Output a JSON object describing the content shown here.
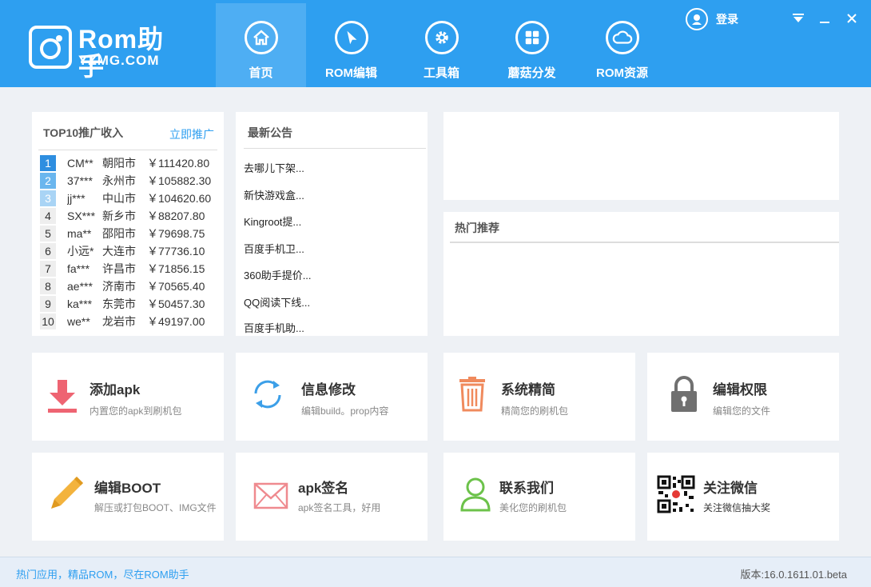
{
  "app": {
    "logo_text": "Rom助手",
    "logo_domain": "YZMG.COM"
  },
  "nav": [
    {
      "label": "首页",
      "icon": "home-icon",
      "active": true
    },
    {
      "label": "ROM编辑",
      "icon": "cursor-icon",
      "active": false
    },
    {
      "label": "工具箱",
      "icon": "gear-icon",
      "active": false
    },
    {
      "label": "蘑菇分发",
      "icon": "grid-icon",
      "active": false
    },
    {
      "label": "ROM资源",
      "icon": "cloud-icon",
      "active": false
    }
  ],
  "header": {
    "login_label": "登录"
  },
  "top10": {
    "title": "TOP10推广收入",
    "promo_link": "立即推广",
    "rows": [
      {
        "rank": "1",
        "user": "CM**",
        "city": "朝阳市",
        "amount": "￥111420.80"
      },
      {
        "rank": "2",
        "user": "37***",
        "city": "永州市",
        "amount": "￥105882.30"
      },
      {
        "rank": "3",
        "user": "jj***",
        "city": "中山市",
        "amount": "￥104620.60"
      },
      {
        "rank": "4",
        "user": "SX***",
        "city": "新乡市",
        "amount": "￥88207.80"
      },
      {
        "rank": "5",
        "user": "ma**",
        "city": "邵阳市",
        "amount": "￥79698.75"
      },
      {
        "rank": "6",
        "user": "小远*",
        "city": "大连市",
        "amount": "￥77736.10"
      },
      {
        "rank": "7",
        "user": "fa***",
        "city": "许昌市",
        "amount": "￥71856.15"
      },
      {
        "rank": "8",
        "user": "ae***",
        "city": "济南市",
        "amount": "￥70565.40"
      },
      {
        "rank": "9",
        "user": "ka***",
        "city": "东莞市",
        "amount": "￥50457.30"
      },
      {
        "rank": "10",
        "user": "we**",
        "city": "龙岩市",
        "amount": "￥49197.00"
      }
    ]
  },
  "notice": {
    "title": "最新公告",
    "items": [
      "去哪儿下架...",
      "新快游戏盒...",
      "Kingroot提...",
      "百度手机卫...",
      "360助手提价...",
      "QQ阅读下线...",
      "百度手机助..."
    ]
  },
  "hot": {
    "title": "热门推荐"
  },
  "tiles": [
    {
      "title": "添加apk",
      "sub": "内置您的apk到刷机包",
      "icon": "download-icon"
    },
    {
      "title": "信息修改",
      "sub": "编辑build。prop内容",
      "icon": "refresh-icon"
    },
    {
      "title": "系统精简",
      "sub": "精简您的刷机包",
      "icon": "trash-icon"
    },
    {
      "title": "编辑权限",
      "sub": "编辑您的文件",
      "icon": "lock-icon"
    },
    {
      "title": "编辑BOOT",
      "sub": "解压或打包BOOT、IMG文件",
      "icon": "pencil-icon"
    },
    {
      "title": "apk签名",
      "sub": "apk签名工具，好用",
      "icon": "envelope-icon"
    },
    {
      "title": "联系我们",
      "sub": "美化您的刷机包",
      "icon": "user-icon"
    },
    {
      "title": "关注微信",
      "sub": "关注微信抽大奖",
      "icon": "qrcode-icon"
    }
  ],
  "footer": {
    "slogan": "热门应用，精品ROM，尽在ROM助手",
    "version": "版本:16.0.1611.01.beta"
  },
  "colors": {
    "header_bg": "#2e9ff0",
    "nav_active": "#4eaef3",
    "rank_1": "#2e8ee0",
    "rank_2": "#6ab6ee",
    "rank_3": "#a9d4f5"
  }
}
